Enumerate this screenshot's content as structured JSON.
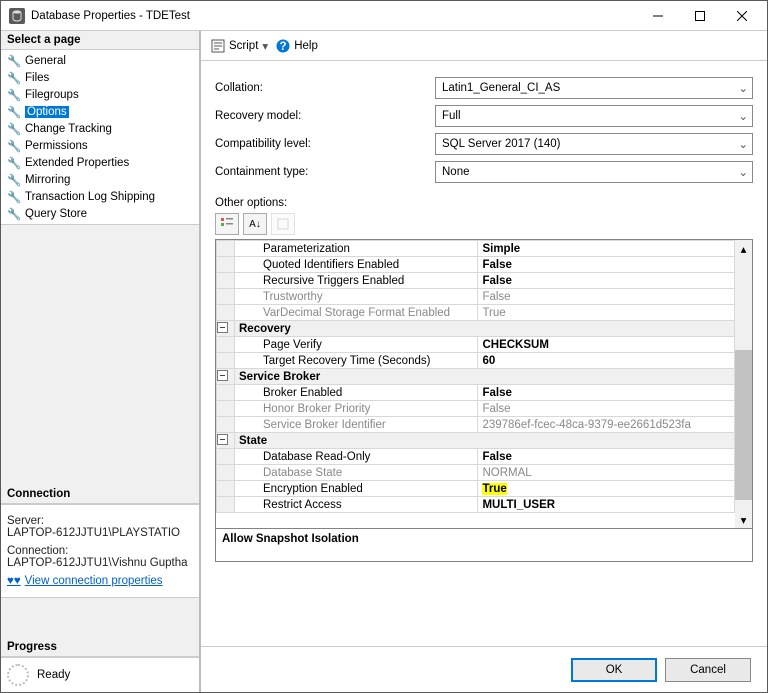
{
  "title": "Database Properties - TDETest",
  "sidebar": {
    "select_page": "Select a page",
    "pages": [
      {
        "label": "General",
        "selected": false
      },
      {
        "label": "Files",
        "selected": false
      },
      {
        "label": "Filegroups",
        "selected": false
      },
      {
        "label": "Options",
        "selected": true
      },
      {
        "label": "Change Tracking",
        "selected": false
      },
      {
        "label": "Permissions",
        "selected": false
      },
      {
        "label": "Extended Properties",
        "selected": false
      },
      {
        "label": "Mirroring",
        "selected": false
      },
      {
        "label": "Transaction Log Shipping",
        "selected": false
      },
      {
        "label": "Query Store",
        "selected": false
      }
    ],
    "connection_header": "Connection",
    "server_label": "Server:",
    "server_value": "LAPTOP-612JJTU1\\PLAYSTATIO",
    "connection_label": "Connection:",
    "connection_value": "LAPTOP-612JJTU1\\Vishnu Guptha",
    "view_conn": "View connection properties",
    "progress_header": "Progress",
    "progress_status": "Ready"
  },
  "cmdbar": {
    "script": "Script",
    "help": "Help"
  },
  "form": {
    "collation": {
      "label": "Collation:",
      "value": "Latin1_General_CI_AS"
    },
    "recovery": {
      "label": "Recovery model:",
      "value": "Full"
    },
    "compat": {
      "label": "Compatibility level:",
      "value": "SQL Server 2017 (140)"
    },
    "containment": {
      "label": "Containment type:",
      "value": "None"
    },
    "other_options": "Other options:"
  },
  "grid": [
    {
      "type": "row",
      "name": "Parameterization",
      "value": "Simple"
    },
    {
      "type": "row",
      "name": "Quoted Identifiers Enabled",
      "value": "False"
    },
    {
      "type": "row",
      "name": "Recursive Triggers Enabled",
      "value": "False"
    },
    {
      "type": "row",
      "name": "Trustworthy",
      "value": "False",
      "disabled": true
    },
    {
      "type": "row",
      "name": "VarDecimal Storage Format Enabled",
      "value": "True",
      "disabled": true
    },
    {
      "type": "cat",
      "name": "Recovery"
    },
    {
      "type": "row",
      "name": "Page Verify",
      "value": "CHECKSUM"
    },
    {
      "type": "row",
      "name": "Target Recovery Time (Seconds)",
      "value": "60"
    },
    {
      "type": "cat",
      "name": "Service Broker"
    },
    {
      "type": "row",
      "name": "Broker Enabled",
      "value": "False"
    },
    {
      "type": "row",
      "name": "Honor Broker Priority",
      "value": "False",
      "disabled": true
    },
    {
      "type": "row",
      "name": "Service Broker Identifier",
      "value": "239786ef-fcec-48ca-9379-ee2661d523fa",
      "disabled": true
    },
    {
      "type": "cat",
      "name": "State"
    },
    {
      "type": "row",
      "name": "Database Read-Only",
      "value": "False"
    },
    {
      "type": "row",
      "name": "Database State",
      "value": "NORMAL",
      "disabled": true
    },
    {
      "type": "row",
      "name": "Encryption Enabled",
      "value": "True",
      "highlight": true
    },
    {
      "type": "row",
      "name": "Restrict Access",
      "value": "MULTI_USER"
    }
  ],
  "description": "Allow Snapshot Isolation",
  "footer": {
    "ok": "OK",
    "cancel": "Cancel"
  }
}
